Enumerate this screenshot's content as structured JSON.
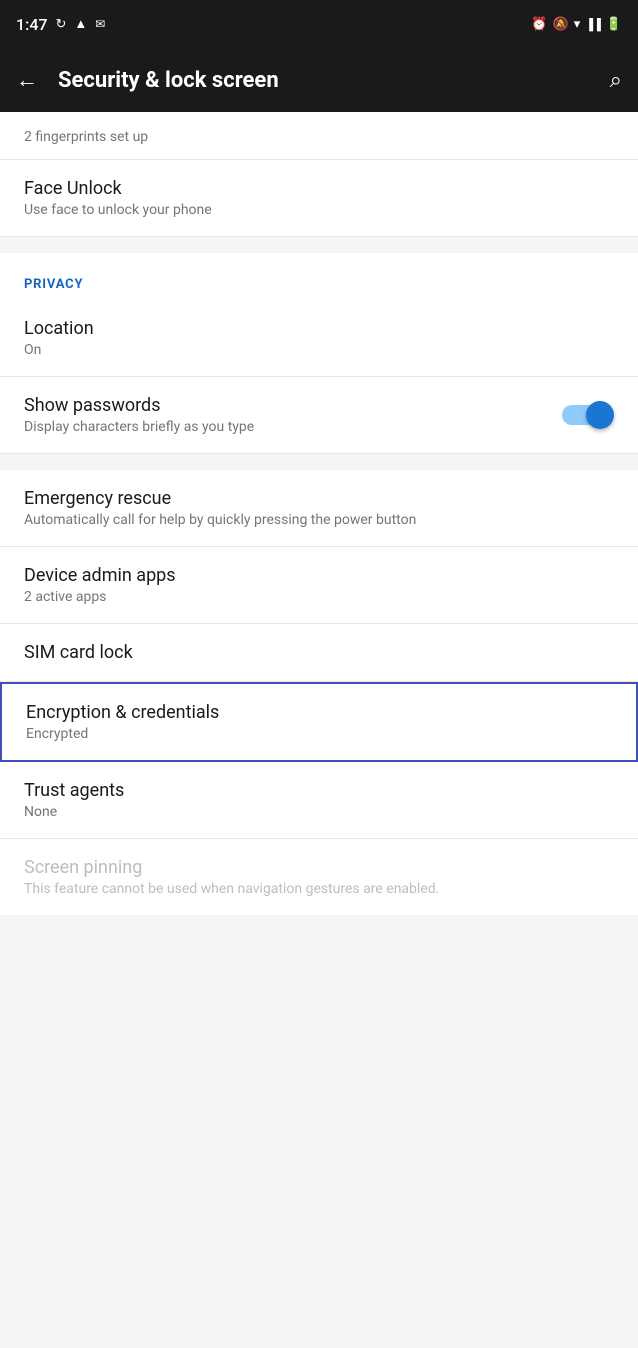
{
  "statusBar": {
    "time": "1:47",
    "icons_left": [
      "sync-icon",
      "location-icon",
      "gmail-icon"
    ],
    "icons_right": [
      "alarm-icon",
      "notification-mute-icon",
      "wifi-icon",
      "signal-icon",
      "battery-icon"
    ]
  },
  "toolbar": {
    "back_label": "←",
    "title": "Security & lock screen",
    "search_label": "⌕"
  },
  "sections": {
    "fingerprint_partial": "2 fingerprints set up",
    "face_unlock": {
      "title": "Face Unlock",
      "subtitle": "Use face to unlock your phone"
    },
    "privacy_header": "PRIVACY",
    "location": {
      "title": "Location",
      "subtitle": "On"
    },
    "show_passwords": {
      "title": "Show passwords",
      "subtitle": "Display characters briefly as you type",
      "toggle_on": true
    },
    "emergency_rescue": {
      "title": "Emergency rescue",
      "subtitle": "Automatically call for help by quickly pressing the power button"
    },
    "device_admin": {
      "title": "Device admin apps",
      "subtitle": "2 active apps"
    },
    "sim_card_lock": {
      "title": "SIM card lock"
    },
    "encryption": {
      "title": "Encryption & credentials",
      "subtitle": "Encrypted"
    },
    "trust_agents": {
      "title": "Trust agents",
      "subtitle": "None"
    },
    "screen_pinning": {
      "title": "Screen pinning",
      "subtitle": "This feature cannot be used when navigation gestures are enabled."
    }
  }
}
